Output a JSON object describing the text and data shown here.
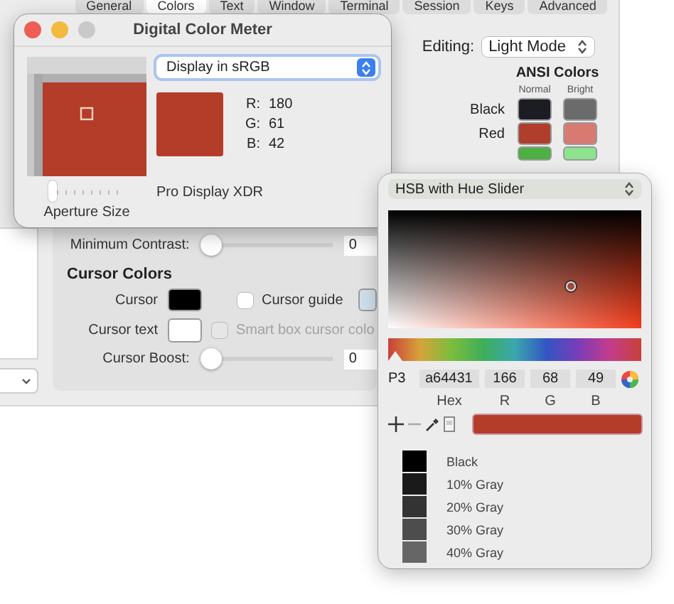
{
  "preferences": {
    "tabs": [
      {
        "label": "General",
        "selected": false
      },
      {
        "label": "Colors",
        "selected": true
      },
      {
        "label": "Text",
        "selected": false
      },
      {
        "label": "Window",
        "selected": false
      },
      {
        "label": "Terminal",
        "selected": false
      },
      {
        "label": "Session",
        "selected": false
      },
      {
        "label": "Keys",
        "selected": false
      },
      {
        "label": "Advanced",
        "selected": false
      }
    ],
    "editing": {
      "label": "Editing:",
      "value": "Light Mode"
    },
    "ansi": {
      "title": "ANSI Colors",
      "columns": [
        "Normal",
        "Bright"
      ],
      "rows": [
        {
          "name": "Black",
          "swatches": [
            {
              "color": "#1b1d22"
            },
            {
              "color": "#6b6b6b"
            }
          ]
        },
        {
          "name": "Red",
          "swatches": [
            {
              "color": "#b03e2c"
            },
            {
              "color": "#d97a72"
            }
          ]
        },
        {
          "swatches": [
            {
              "color": "#4cb043"
            },
            {
              "color": "#8ee38f"
            }
          ]
        }
      ]
    },
    "minimum_contrast": {
      "label": "Minimum Contrast:",
      "level": 0,
      "value": "0"
    },
    "cursor_colors": {
      "title": "Cursor Colors",
      "cursor": {
        "label": "Cursor",
        "color": "#000000"
      },
      "cursor_guide": {
        "label": "Cursor guide",
        "checked": false,
        "color": "#cfe0ec"
      },
      "cursor_text": {
        "label": "Cursor text",
        "color": "#ffffff"
      },
      "smart_box": {
        "label": "Smart box cursor colo",
        "checked": false,
        "disabled": true
      },
      "cursor_boost": {
        "label": "Cursor Boost:",
        "level": 0,
        "value": "0"
      }
    }
  },
  "color_meter": {
    "title": "Digital Color Meter",
    "mode": "Display in sRGB",
    "channels": [
      {
        "label": "R:",
        "value": "180"
      },
      {
        "label": "G:",
        "value": "61"
      },
      {
        "label": "B:",
        "value": "42"
      }
    ],
    "display": "Pro Display XDR",
    "aperture": {
      "label": "Aperture Size",
      "level": 0
    }
  },
  "color_panel": {
    "mode": "HSB with Hue Slider",
    "hue": {
      "level": 0
    },
    "space": "P3",
    "fields": [
      {
        "label": "Hex",
        "value": "a64431"
      },
      {
        "label": "R",
        "value": "166"
      },
      {
        "label": "G",
        "value": "68"
      },
      {
        "label": "B",
        "value": "49"
      }
    ],
    "swatches": [
      {
        "name": "Black",
        "color": "#000000"
      },
      {
        "name": "10% Gray",
        "color": "#1a1a1a"
      },
      {
        "name": "20% Gray",
        "color": "#333333"
      },
      {
        "name": "30% Gray",
        "color": "#4d4d4d"
      },
      {
        "name": "40% Gray",
        "color": "#666666"
      }
    ]
  }
}
